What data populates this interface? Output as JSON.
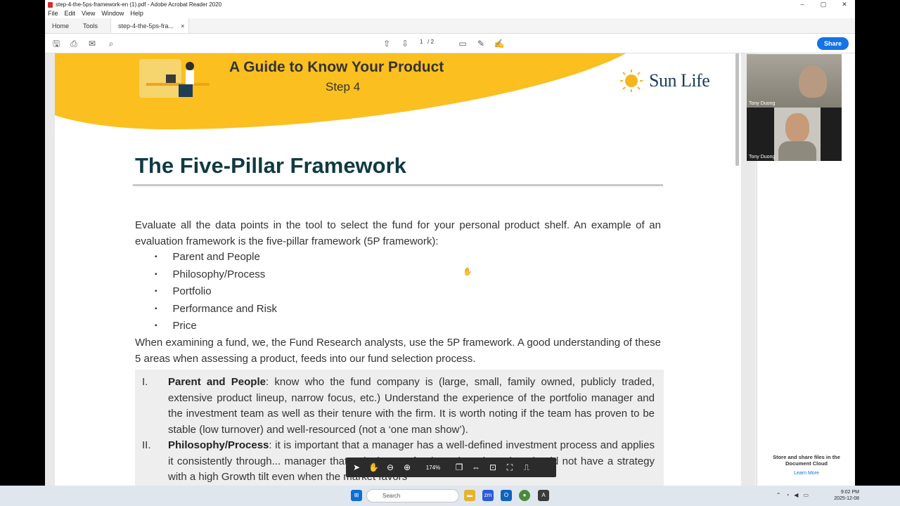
{
  "window": {
    "title": "step-4-the-5ps-framework-en (1).pdf - Adobe Acrobat Reader 2020",
    "controls": [
      "–",
      "▢",
      "✕"
    ]
  },
  "menu": [
    "File",
    "Edit",
    "View",
    "Window",
    "Help"
  ],
  "tabs": {
    "home": "Home",
    "tools": "Tools",
    "doc": "step-4-the-5ps-fra...",
    "close": "×"
  },
  "toolbar": {
    "page_current": "1",
    "page_sep": "/",
    "page_total": "2",
    "share": "Share"
  },
  "document": {
    "banner_title": "A Guide to Know Your Product",
    "banner_sub": "Step 4",
    "brand": "Sun Life",
    "heading": "The Five-Pillar Framework",
    "intro": "Evaluate all the data points in the tool to select the fund for your personal product shelf. An example of an evaluation framework is the five-pillar framework (5P framework):",
    "bullets": [
      "Parent and People",
      "Philosophy/Process",
      "Portfolio",
      "Performance and Risk",
      "Price"
    ],
    "para2": "When examining a fund, we, the Fund Research analysts, use the 5P framework. A good understanding of these 5 areas when assessing a product, feeds into our fund selection process.",
    "items": [
      {
        "num": "I.",
        "bold": "Parent and People",
        "text": ": know who the fund company is (large, small, family owned, publicly traded, extensive product lineup, narrow focus, etc.) Understand the experience of the portfolio manager and the investment team as well as their tenure with the firm. It is worth noting if the team has proven to be stable (low turnover) and well-resourced (not a ‘one man show’)."
      },
      {
        "num": "II.",
        "bold": "Philosophy/Process",
        "text": ": it is important that a manager has a well-defined investment process and applies it consistently through... manager that articulates a fund’s style to be value should not have a strategy with a high Growth tilt even when the market favors"
      }
    ]
  },
  "floatbar": {
    "zoom": "174%"
  },
  "side": {
    "participants": [
      "Tony Duong",
      "Tony Duong"
    ],
    "store": "Store and share files in the Document Cloud",
    "learn": "Learn More"
  },
  "taskbar": {
    "search": "Search",
    "time": "9:02 PM",
    "date": "2025-12-08",
    "zoom_label": "zm"
  }
}
